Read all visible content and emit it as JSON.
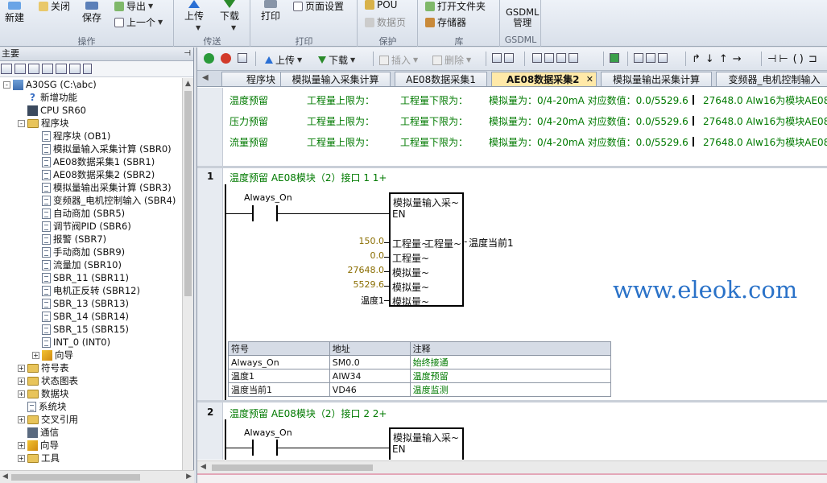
{
  "ribbon": {
    "groups": {
      "operation": "操作",
      "transfer": "传送",
      "print": "打印",
      "protect": "保护",
      "library": "库",
      "gsdml": "GSDML"
    },
    "buttons": {
      "new": "新建",
      "close": "关闭",
      "save": "保存",
      "export": "导出",
      "previous": "上一个",
      "upload": "上传",
      "download": "下载",
      "print": "打印",
      "page_setup": "页面设置",
      "pou": "POU",
      "data_page": "数据页",
      "open_folder": "打开文件夹",
      "memory_card": "存储器",
      "gsdml_manage": "GSDML\n管理"
    }
  },
  "left_pane": {
    "title": "主要",
    "tree": [
      {
        "label": "A30SG (C:\\abc)",
        "indent": 0,
        "icon": "project-icon",
        "expander": "-"
      },
      {
        "label": "新增功能",
        "indent": 1,
        "icon": "help-icon"
      },
      {
        "label": "CPU SR60",
        "indent": 1,
        "icon": "cpu-icon"
      },
      {
        "label": "程序块",
        "indent": 1,
        "icon": "folder-icon",
        "expander": "-"
      },
      {
        "label": "程序块 (OB1)",
        "indent": 2,
        "icon": "doc-icon"
      },
      {
        "label": "模拟量输入采集计算 (SBR0)",
        "indent": 2,
        "icon": "doc-icon"
      },
      {
        "label": "AE08数据采集1 (SBR1)",
        "indent": 2,
        "icon": "doc-icon"
      },
      {
        "label": "AE08数据采集2 (SBR2)",
        "indent": 2,
        "icon": "doc-icon"
      },
      {
        "label": "模拟量输出采集计算 (SBR3)",
        "indent": 2,
        "icon": "doc-icon"
      },
      {
        "label": "变频器_电机控制输入 (SBR4)",
        "indent": 2,
        "icon": "doc-icon"
      },
      {
        "label": "自动商加 (SBR5)",
        "indent": 2,
        "icon": "doc-icon"
      },
      {
        "label": "调节阀PID (SBR6)",
        "indent": 2,
        "icon": "doc-icon"
      },
      {
        "label": "报警 (SBR7)",
        "indent": 2,
        "icon": "doc-icon"
      },
      {
        "label": "手动商加 (SBR9)",
        "indent": 2,
        "icon": "doc-icon"
      },
      {
        "label": "流量加 (SBR10)",
        "indent": 2,
        "icon": "doc-icon"
      },
      {
        "label": "SBR_11 (SBR11)",
        "indent": 2,
        "icon": "doc-icon"
      },
      {
        "label": "电机正反转 (SBR12)",
        "indent": 2,
        "icon": "doc-icon"
      },
      {
        "label": "SBR_13 (SBR13)",
        "indent": 2,
        "icon": "doc-icon"
      },
      {
        "label": "SBR_14 (SBR14)",
        "indent": 2,
        "icon": "doc-icon"
      },
      {
        "label": "SBR_15 (SBR15)",
        "indent": 2,
        "icon": "doc-icon"
      },
      {
        "label": "INT_0 (INT0)",
        "indent": 2,
        "icon": "doc-icon"
      },
      {
        "label": "向导",
        "indent": 2,
        "icon": "wizard-icon",
        "expander": "+"
      },
      {
        "label": "符号表",
        "indent": 1,
        "icon": "folder-icon",
        "expander": "+"
      },
      {
        "label": "状态图表",
        "indent": 1,
        "icon": "folder-icon",
        "expander": "+"
      },
      {
        "label": "数据块",
        "indent": 1,
        "icon": "folder-icon",
        "expander": "+"
      },
      {
        "label": "系统块",
        "indent": 1,
        "icon": "doc-icon"
      },
      {
        "label": "交叉引用",
        "indent": 1,
        "icon": "folder-icon",
        "expander": "+"
      },
      {
        "label": "通信",
        "indent": 1,
        "icon": "comm-icon"
      },
      {
        "label": "向导",
        "indent": 1,
        "icon": "wizard-icon",
        "expander": "+"
      },
      {
        "label": "工具",
        "indent": 1,
        "icon": "folder-icon",
        "expander": "+"
      }
    ]
  },
  "editor": {
    "toolbar": {
      "upload": "上传",
      "download": "下载",
      "insert": "插入",
      "delete": "删除"
    },
    "tabs": [
      {
        "label": "程序块",
        "active": false
      },
      {
        "label": "模拟量输入采集计算",
        "active": false
      },
      {
        "label": "AE08数据采集1",
        "active": false
      },
      {
        "label": "AE08数据采集2",
        "active": true
      },
      {
        "label": "模拟量输出采集计算",
        "active": false
      },
      {
        "label": "变频器_电机控制输入",
        "active": false
      }
    ],
    "header_comments": [
      {
        "c1": "温度预留",
        "c2": "工程量上限为：",
        "c3": "工程量下限为：",
        "c4": "模拟量为：0/4-20mA 对应数值：0.0/5529.6",
        "c5": "27648.0  AIw16为模块AE08"
      },
      {
        "c1": "压力预留",
        "c2": "工程量上限为：",
        "c3": "工程量下限为：",
        "c4": "模拟量为：0/4-20mA 对应数值：0.0/5529.6",
        "c5": "27648.0  AIw16为模块AE08"
      },
      {
        "c1": "流量预留",
        "c2": "工程量上限为：",
        "c3": "工程量下限为：",
        "c4": "模拟量为：0/4-20mA 对应数值：0.0/5529.6",
        "c5": "27648.0  AIw16为模块AE08"
      }
    ],
    "network1": {
      "number": "1",
      "title": "温度预留   AE08模块（2）接口 1 1+",
      "contact": "Always_On",
      "box_title": "模拟量输入采~",
      "en": "EN",
      "inputs": [
        {
          "value": "150.0",
          "pin": "工程量~"
        },
        {
          "value": "0.0",
          "pin": "工程量~"
        },
        {
          "value": "27648.0",
          "pin": "模拟量~"
        },
        {
          "value": "5529.6",
          "pin": "模拟量~"
        },
        {
          "value": "温度1",
          "pin": "模拟量~"
        }
      ],
      "output_pin": "工程量~",
      "output_value": "温度当前1",
      "symbols": {
        "headers": [
          "符号",
          "地址",
          "注释"
        ],
        "rows": [
          [
            "Always_On",
            "SM0.0",
            "始终接通"
          ],
          [
            "温度1",
            "AIW34",
            "温度预留"
          ],
          [
            "温度当前1",
            "VD46",
            "温度监测"
          ]
        ]
      }
    },
    "network2": {
      "number": "2",
      "title": "温度预留   AE08模块（2）接口 2 2+",
      "contact": "Always_On",
      "box_title": "模拟量输入采~",
      "en": "EN"
    },
    "watermark": "www.eleok.com"
  }
}
